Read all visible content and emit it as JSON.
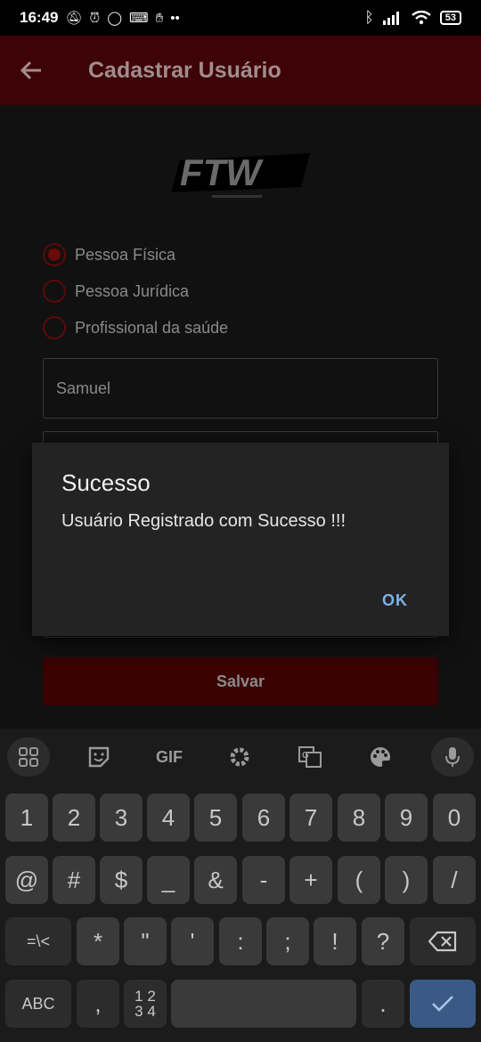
{
  "status_bar": {
    "time": "16:49",
    "battery": "53",
    "left_icons": [
      "mute-icon",
      "alarm-icon",
      "whatsapp-icon",
      "keyboard-icon",
      "hand-icon",
      "more-icon"
    ],
    "right_icons": [
      "bluetooth-icon",
      "signal-icon",
      "wifi-icon",
      "battery-icon"
    ]
  },
  "app_bar": {
    "title": "Cadastrar Usuário",
    "accent": "#3e0306"
  },
  "logo": {
    "text": "FTW"
  },
  "form": {
    "radios": [
      {
        "label": "Pessoa Física",
        "selected": true
      },
      {
        "label": "Pessoa Jurídica",
        "selected": false
      },
      {
        "label": "Profissional da saúde",
        "selected": false
      }
    ],
    "name_value": "Samuel",
    "save_label": "Salvar"
  },
  "dialog": {
    "title": "Sucesso",
    "message": "Usuário Registrado com Sucesso !!!",
    "ok_label": "OK"
  },
  "keyboard": {
    "toolbar": [
      "apps-icon",
      "sticker-icon",
      "GIF",
      "settings-icon",
      "translate-icon",
      "palette-icon",
      "mic-icon"
    ],
    "row1": [
      "1",
      "2",
      "3",
      "4",
      "5",
      "6",
      "7",
      "8",
      "9",
      "0"
    ],
    "row2": [
      "@",
      "#",
      "$",
      "_",
      "&",
      "-",
      "+",
      "(",
      ")",
      "/"
    ],
    "row3": [
      "=\\<",
      "*",
      "\"",
      "'",
      ":",
      ";",
      "!",
      "?"
    ],
    "row4": {
      "abc": "ABC",
      "comma": ",",
      "numpad_top": "1 2",
      "numpad_bottom": "3 4",
      "period": "."
    },
    "colors": {
      "key": "#3a3a3a",
      "enter": "#3a5a86"
    }
  }
}
